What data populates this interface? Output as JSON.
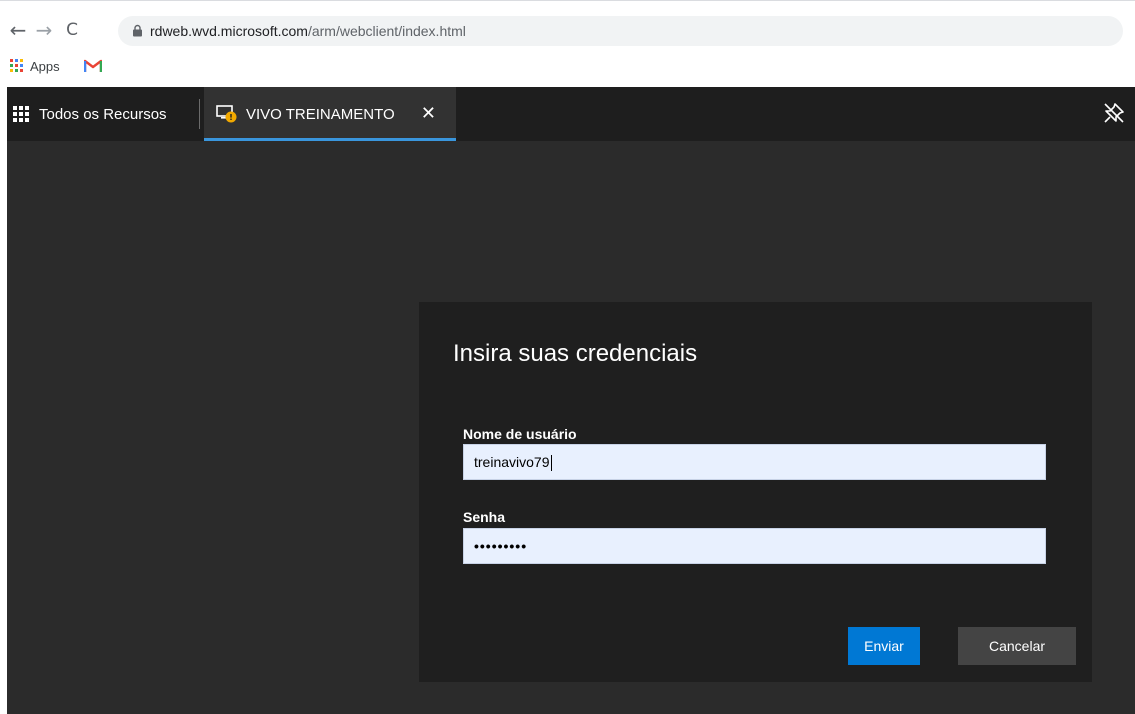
{
  "browser": {
    "url_host": "rdweb.wvd.microsoft.com",
    "url_path": "/arm/webclient/index.html",
    "bookmarks": [
      {
        "label": "Apps",
        "icon": "apps-grid-icon"
      },
      {
        "label": "",
        "icon": "gmail-icon"
      }
    ]
  },
  "rdclient": {
    "all_resources_label": "Todos os Recursos",
    "session_tab": {
      "label": "VIVO TREINAMENTO",
      "close": "✕"
    },
    "accent_color": "#3a96dd"
  },
  "dialog": {
    "title": "Insira suas credenciais",
    "username_label": "Nome de usuário",
    "username_value": "treinavivo79",
    "password_label": "Senha",
    "password_mask": "•••••••••",
    "submit_label": "Enviar",
    "cancel_label": "Cancelar",
    "submit_color": "#0078d4"
  }
}
